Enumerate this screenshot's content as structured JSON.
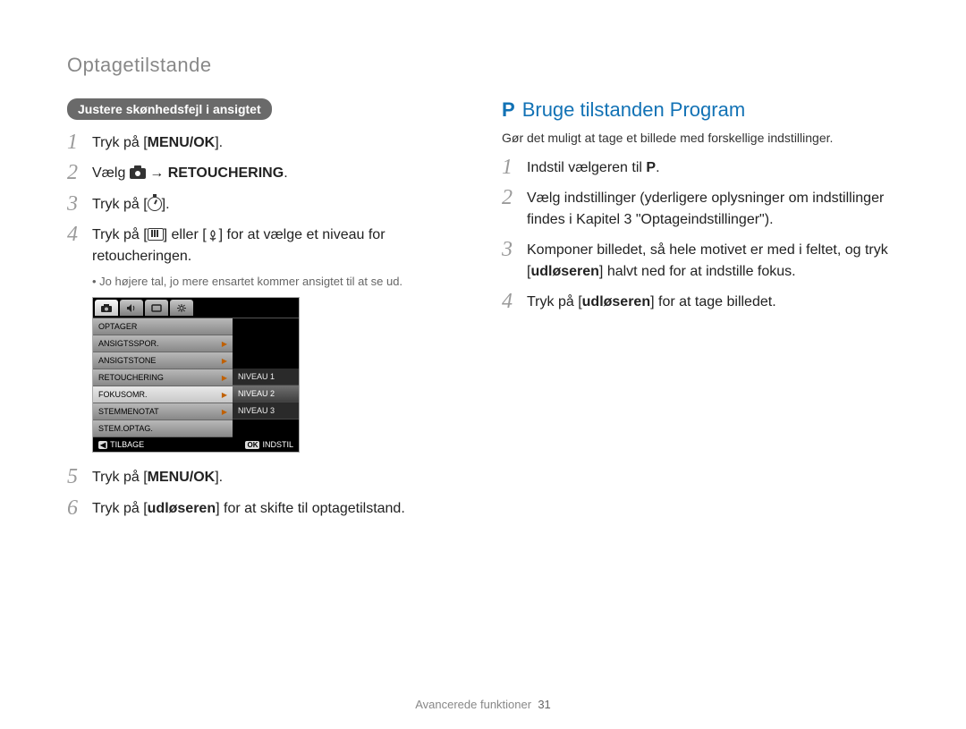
{
  "header": {
    "title": "Optagetilstande"
  },
  "left": {
    "section_pill": "Justere skønhedsfejl i ansigtet",
    "steps": [
      {
        "n": "1",
        "pre": "Tryk på [",
        "bold": "MENU/OK",
        "post": "]."
      },
      {
        "n": "2",
        "vary": "Vælg ",
        "arrow": " → ",
        "bold2": "RETOUCHERING",
        "post2": "."
      },
      {
        "n": "3",
        "pre": "Tryk på [",
        "post": "]."
      },
      {
        "n": "4",
        "pre": "Tryk på [",
        "mid": "] eller [",
        "post": "] for at vælge et niveau for retoucheringen."
      },
      {
        "n": "5",
        "pre": "Tryk på [",
        "bold": "MENU/OK",
        "post": "]."
      },
      {
        "n": "6",
        "pre": "Tryk på [",
        "bold": "udløseren",
        "post": "] for at skifte til optagetilstand."
      }
    ],
    "note": "Jo højere tal, jo mere ensartet kommer ansigtet til at se ud."
  },
  "cam": {
    "tabs": [
      "camera",
      "sound",
      "display",
      "settings"
    ],
    "menu": [
      "OPTAGER",
      "ANSIGTSSPOR.",
      "ANSIGTSTONE",
      "RETOUCHERING",
      "FOKUSOMR.",
      "STEMMENOTAT",
      "STEM.OPTAG."
    ],
    "selected_menu_index": 4,
    "submenu": [
      "NIVEAU 1",
      "NIVEAU 2",
      "NIVEAU 3"
    ],
    "selected_sub_index": 1,
    "footer_left_key": "◀",
    "footer_left": "TILBAGE",
    "footer_right_key": "OK",
    "footer_right": "INDSTIL"
  },
  "right": {
    "heading_icon": "P",
    "heading": "Bruge tilstanden Program",
    "subtitle": "Gør det muligt at tage et billede med forskellige indstillinger.",
    "steps": [
      {
        "n": "1",
        "pre": "Indstil vælgeren til ",
        "icon": "P",
        "post": "."
      },
      {
        "n": "2",
        "text": "Vælg indstillinger (yderligere oplysninger om indstillinger findes i Kapitel 3 \"Optageindstillinger\")."
      },
      {
        "n": "3",
        "pre": "Komponer billedet, så hele motivet er med i feltet, og tryk [",
        "bold": "udløseren",
        "post": "] halvt ned for at indstille fokus."
      },
      {
        "n": "4",
        "pre": "Tryk på [",
        "bold": "udløseren",
        "post": "] for at tage billedet."
      }
    ]
  },
  "footer": {
    "section": "Avancerede funktioner",
    "page": "31"
  }
}
